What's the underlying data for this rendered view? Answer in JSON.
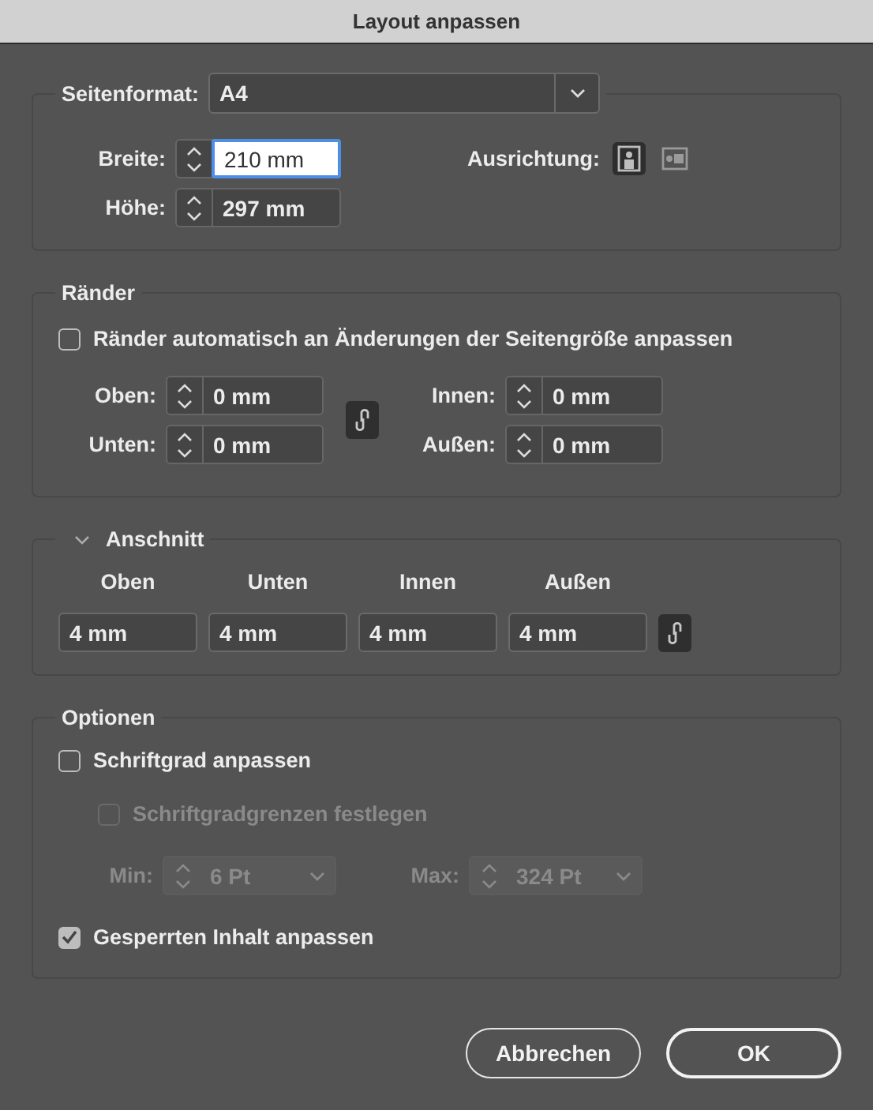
{
  "window": {
    "title": "Layout anpassen"
  },
  "page_size": {
    "label": "Seitenformat:",
    "value": "A4"
  },
  "width": {
    "label": "Breite:",
    "value": "210 mm",
    "focused": true
  },
  "height": {
    "label": "Höhe:",
    "value": "297 mm",
    "focused": false
  },
  "orientation": {
    "label": "Ausrichtung:",
    "options": [
      {
        "kind": "portrait",
        "selected": true
      },
      {
        "kind": "landscape",
        "selected": false
      }
    ]
  },
  "margins": {
    "title": "Ränder",
    "auto_adjust": {
      "label": "Ränder automatisch an Änderungen der Seitengröße anpassen",
      "checked": false
    },
    "linked": true,
    "fields": [
      {
        "label": "Oben:",
        "value": "0 mm"
      },
      {
        "label": "Unten:",
        "value": "0 mm"
      },
      {
        "label": "Innen:",
        "value": "0 mm"
      },
      {
        "label": "Außen:",
        "value": "0 mm"
      }
    ]
  },
  "bleed": {
    "title": "Anschnitt",
    "expanded": true,
    "linked": true,
    "fields": [
      {
        "label": "Oben",
        "value": "4 mm"
      },
      {
        "label": "Unten",
        "value": "4 mm"
      },
      {
        "label": "Innen",
        "value": "4 mm"
      },
      {
        "label": "Außen",
        "value": "4 mm"
      }
    ]
  },
  "options": {
    "title": "Optionen",
    "font_size": {
      "label": "Schriftgrad anpassen",
      "checked": false,
      "disabled": false
    },
    "limits": {
      "label": "Schriftgradgrenzen festlegen",
      "checked": false,
      "disabled": true
    },
    "min": {
      "label": "Min:",
      "value": "6 Pt",
      "disabled": true
    },
    "max": {
      "label": "Max:",
      "value": "324 Pt",
      "disabled": true
    },
    "locked": {
      "label": "Gesperrten Inhalt anpassen",
      "checked": true,
      "disabled": false
    }
  },
  "buttons": [
    {
      "label": "Abbrechen",
      "kind": "cancel"
    },
    {
      "label": "OK",
      "kind": "default"
    }
  ]
}
